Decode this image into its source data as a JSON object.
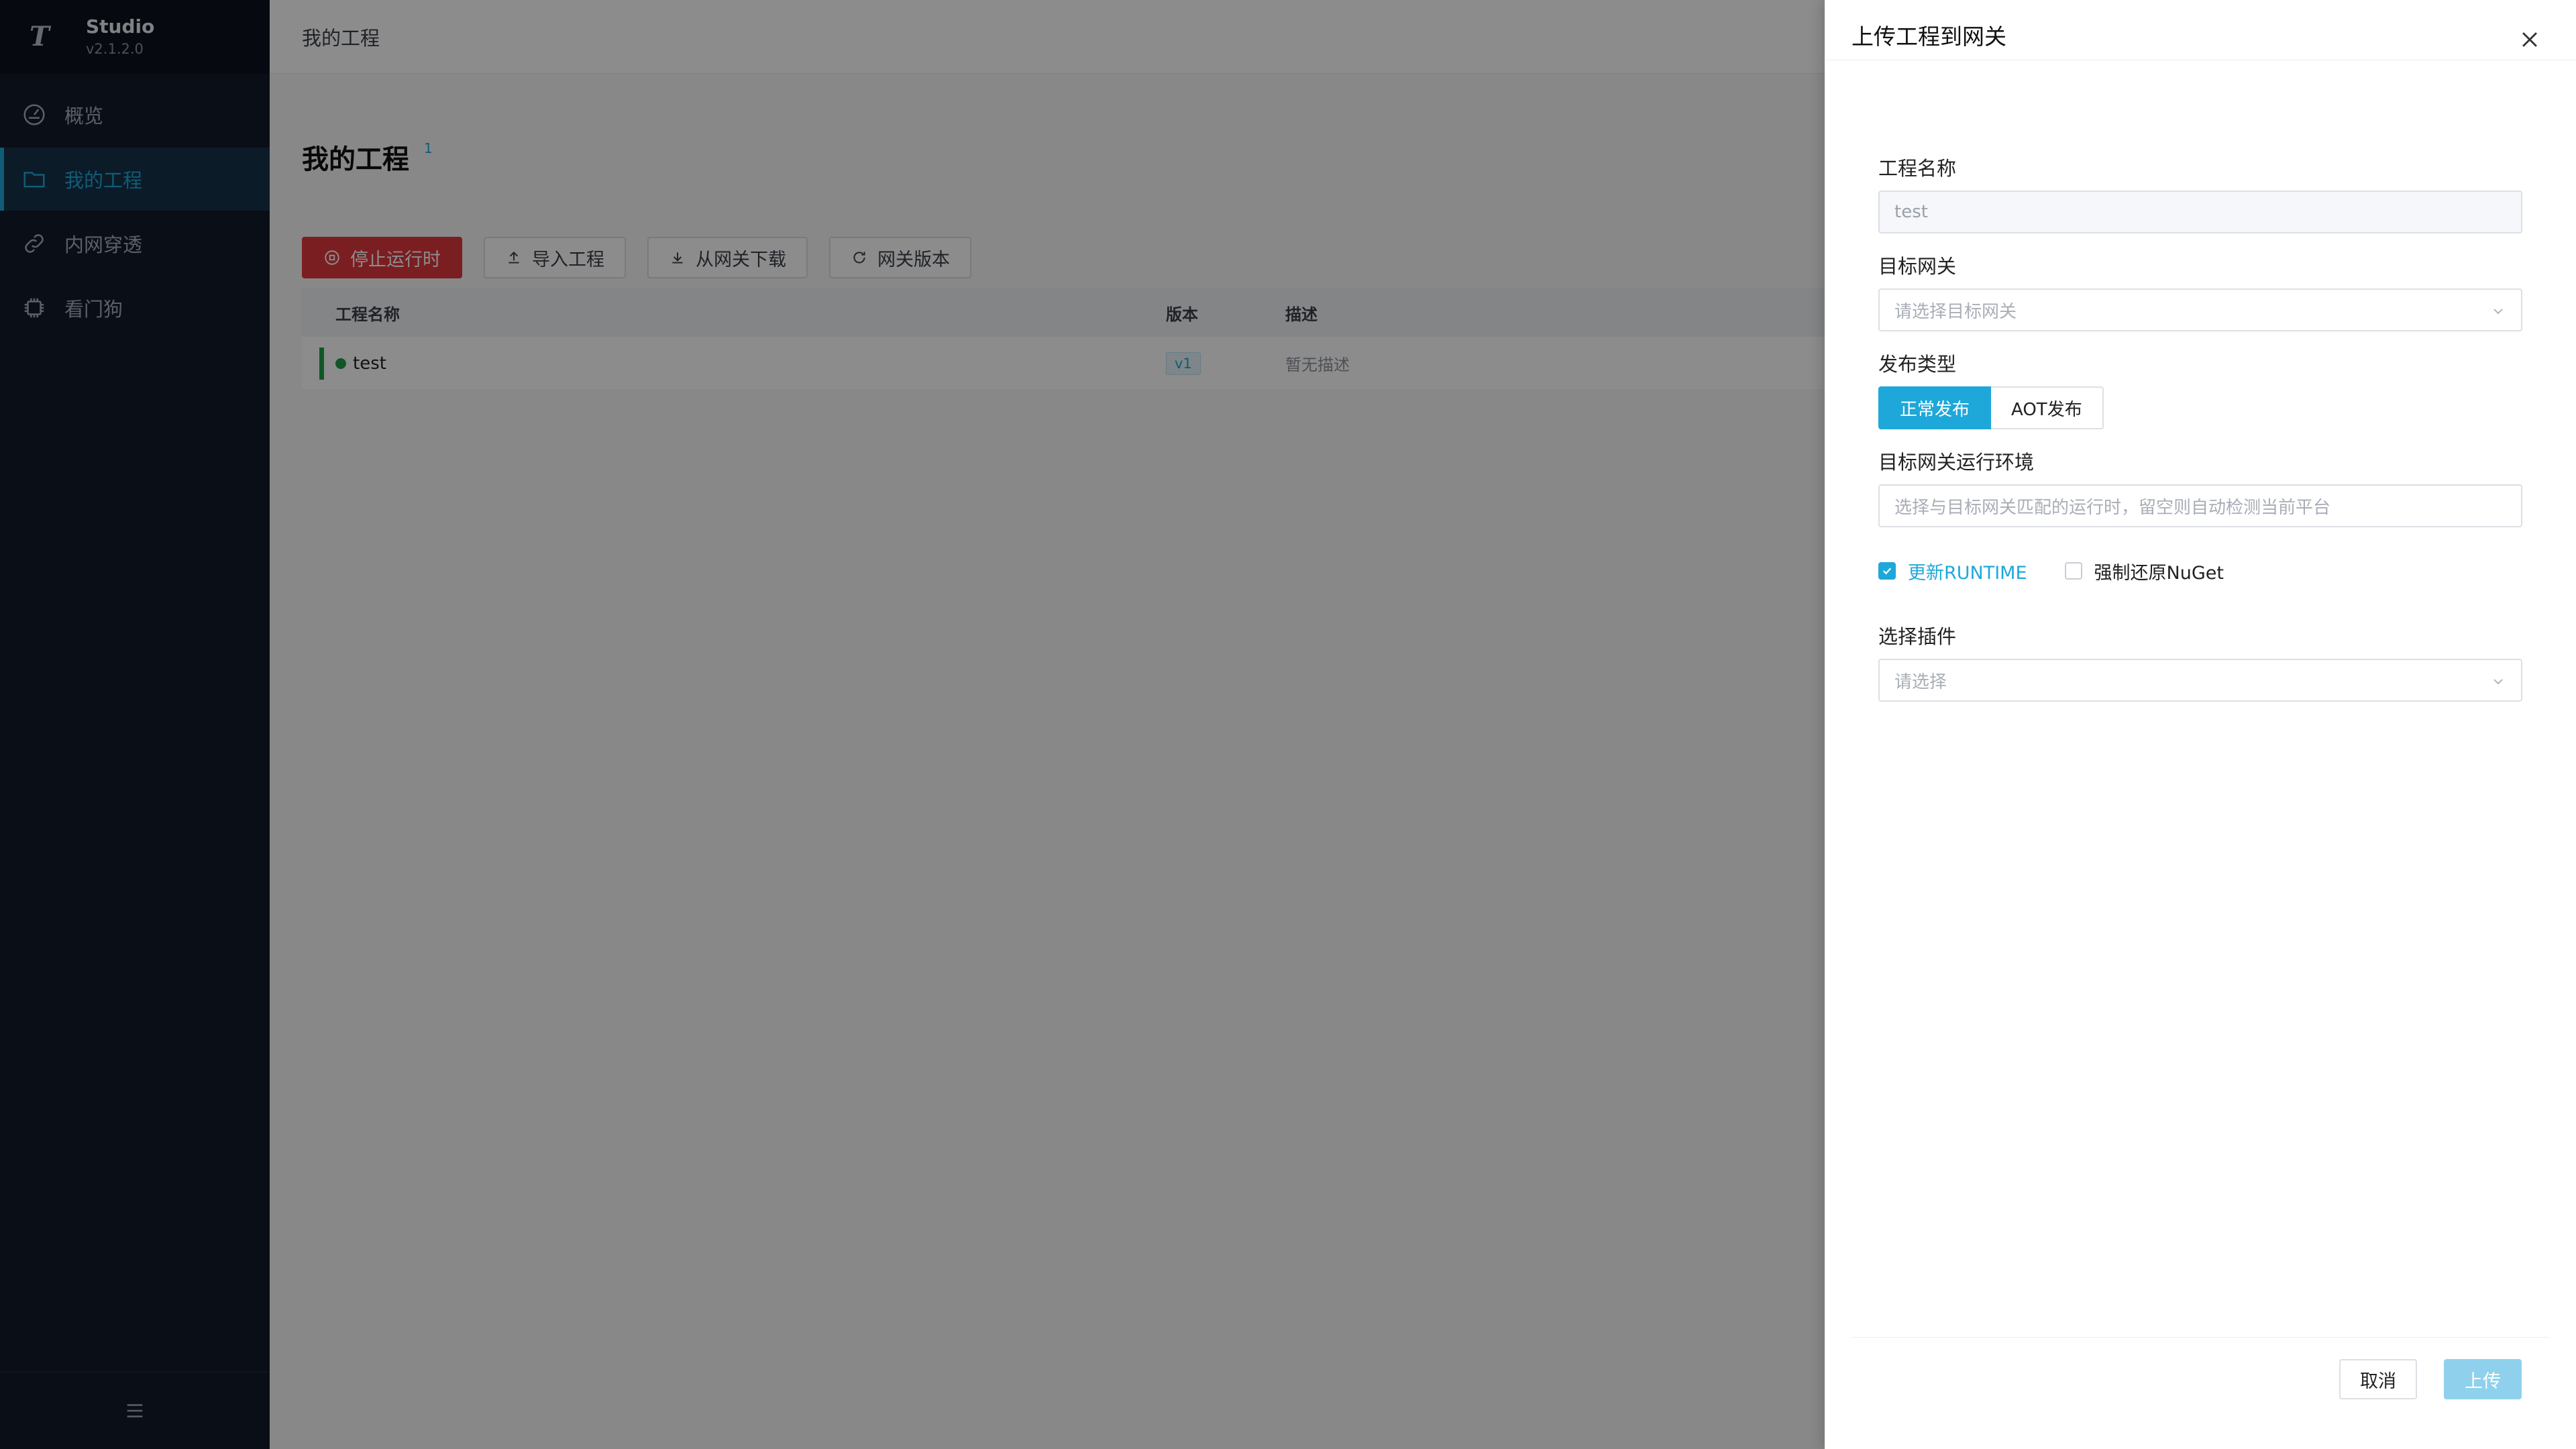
{
  "app": {
    "name": "Studio",
    "version": "v2.1.2.0"
  },
  "sidebar": {
    "items": [
      {
        "label": "概览",
        "icon": "dashboard-icon"
      },
      {
        "label": "我的工程",
        "icon": "folder-icon",
        "active": true
      },
      {
        "label": "内网穿透",
        "icon": "link-icon"
      },
      {
        "label": "看门狗",
        "icon": "chip-icon"
      }
    ]
  },
  "topbar": {
    "breadcrumb": "我的工程"
  },
  "page": {
    "title": "我的工程",
    "count": "1"
  },
  "toolbar": {
    "stop_runtime": "停止运行时",
    "import_project": "导入工程",
    "download_from_gateway": "从网关下载",
    "gateway_version": "网关版本"
  },
  "table": {
    "headers": {
      "name": "工程名称",
      "version": "版本",
      "description": "描述"
    },
    "rows": [
      {
        "name": "test",
        "version": "v1",
        "description": "暂无描述",
        "status": "running"
      }
    ]
  },
  "drawer": {
    "title": "上传工程到网关",
    "fields": {
      "project_name_label": "工程名称",
      "project_name_value": "test",
      "target_gateway_label": "目标网关",
      "target_gateway_placeholder": "请选择目标网关",
      "publish_type_label": "发布类型",
      "publish_normal": "正常发布",
      "publish_aot": "AOT发布",
      "runtime_env_label": "目标网关运行环境",
      "runtime_env_placeholder": "选择与目标网关匹配的运行时，留空则自动检测当前平台",
      "update_runtime": "更新RUNTIME",
      "force_restore_nuget": "强制还原NuGet",
      "plugins_label": "选择插件",
      "plugins_placeholder": "请选择"
    },
    "update_runtime_checked": true,
    "force_restore_checked": false,
    "cancel": "取消",
    "submit": "上传"
  },
  "colors": {
    "accent": "#1ea8d9",
    "danger": "#e0383e",
    "sidebar_bg": "#131b2a",
    "running": "#1f9d4a"
  }
}
